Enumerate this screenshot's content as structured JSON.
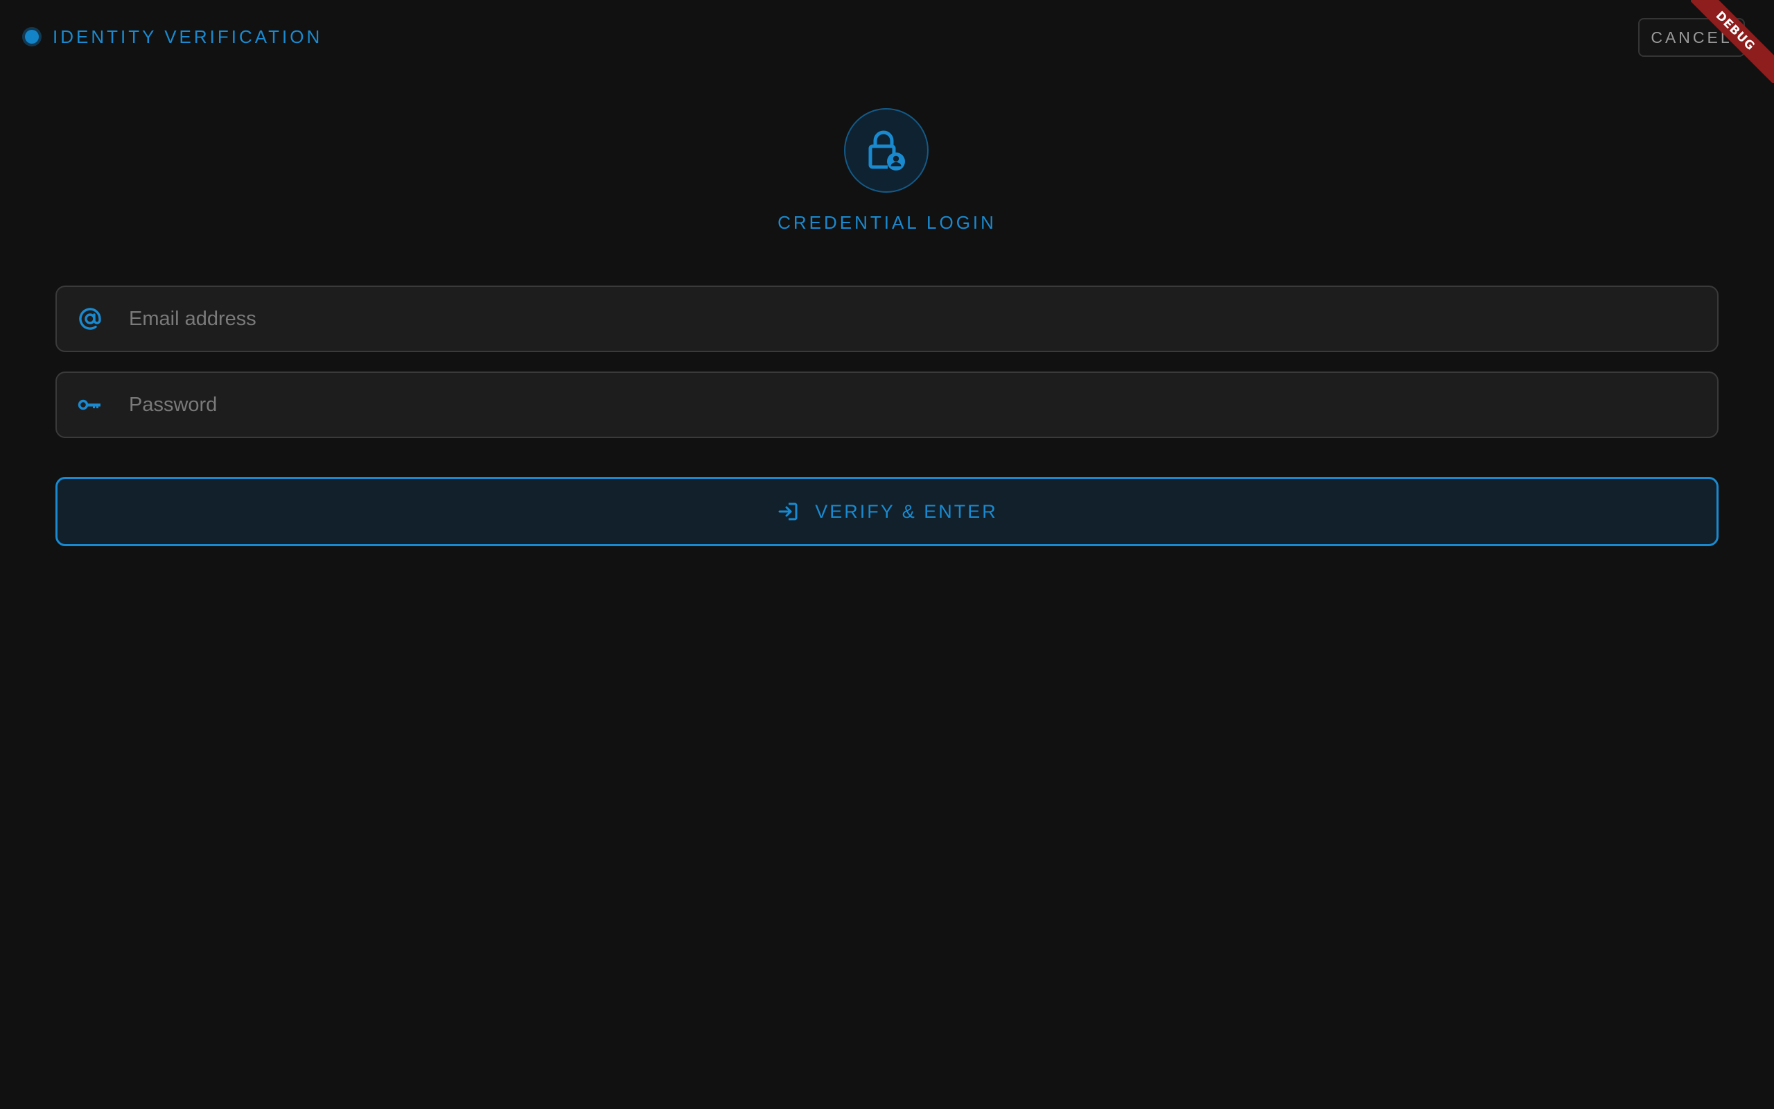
{
  "header": {
    "title": "IDENTITY VERIFICATION",
    "status_icon": "status-dot-icon",
    "cancel_label": "CANCEL"
  },
  "debug_banner": {
    "label": "DEBUG"
  },
  "hero": {
    "icon": "lock-person-icon",
    "title": "CREDENTIAL LOGIN"
  },
  "form": {
    "email": {
      "icon": "at-sign-icon",
      "placeholder": "Email address",
      "value": ""
    },
    "password": {
      "icon": "key-icon",
      "placeholder": "Password",
      "value": ""
    },
    "submit": {
      "icon": "login-icon",
      "label": "VERIFY & ENTER"
    }
  },
  "colors": {
    "accent": "#1a8ad0",
    "background": "#111111",
    "field_background": "#1d1d1d",
    "debug_ribbon": "#8e1d1d"
  }
}
